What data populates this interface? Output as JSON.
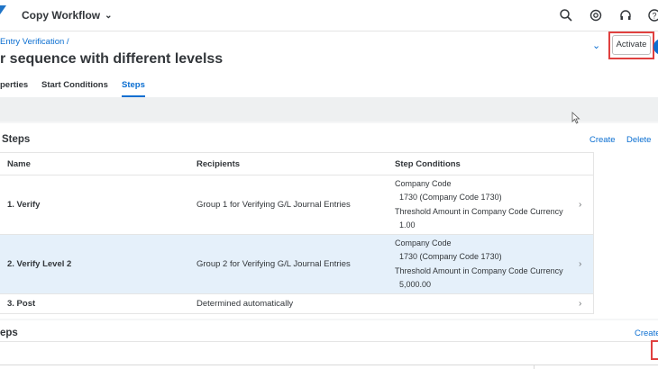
{
  "shell": {
    "app_title": "Copy Workflow",
    "icons": [
      "search-icon",
      "notifications-icon",
      "headset-icon",
      "help-icon"
    ]
  },
  "header": {
    "breadcrumb": "Entry Verification /",
    "title": "r sequence with different levelss",
    "activate_label": "Activate",
    "tabs": [
      {
        "label": "perties",
        "active": false
      },
      {
        "label": "Start Conditions",
        "active": false
      },
      {
        "label": "Steps",
        "active": true
      }
    ]
  },
  "steps_panel": {
    "title": "Steps",
    "create_label": "Create",
    "delete_label": "Delete",
    "columns": [
      "Name",
      "Recipients",
      "Step Conditions"
    ],
    "rows": [
      {
        "name": "1. Verify",
        "recipients": "Group 1 for Verifying G/L Journal Entries",
        "conditions": [
          "Company Code",
          "1730 (Company Code 1730)",
          "Threshold Amount in Company Code Currency",
          "1.00"
        ],
        "selected": false
      },
      {
        "name": "2. Verify Level 2",
        "recipients": "Group 2 for Verifying G/L Journal Entries",
        "conditions": [
          "Company Code",
          "1730 (Company Code 1730)",
          "Threshold Amount in Company Code Currency",
          "5,000.00"
        ],
        "selected": true
      },
      {
        "name": "3. Post",
        "recipients": "Determined automatically",
        "conditions": [],
        "selected": false
      }
    ]
  },
  "lower_panel": {
    "title": "eps",
    "create_label": "Create"
  },
  "colors": {
    "accent": "#0a6ed1",
    "highlight_red": "#e0403f",
    "selected_row": "#e5f0fa"
  }
}
